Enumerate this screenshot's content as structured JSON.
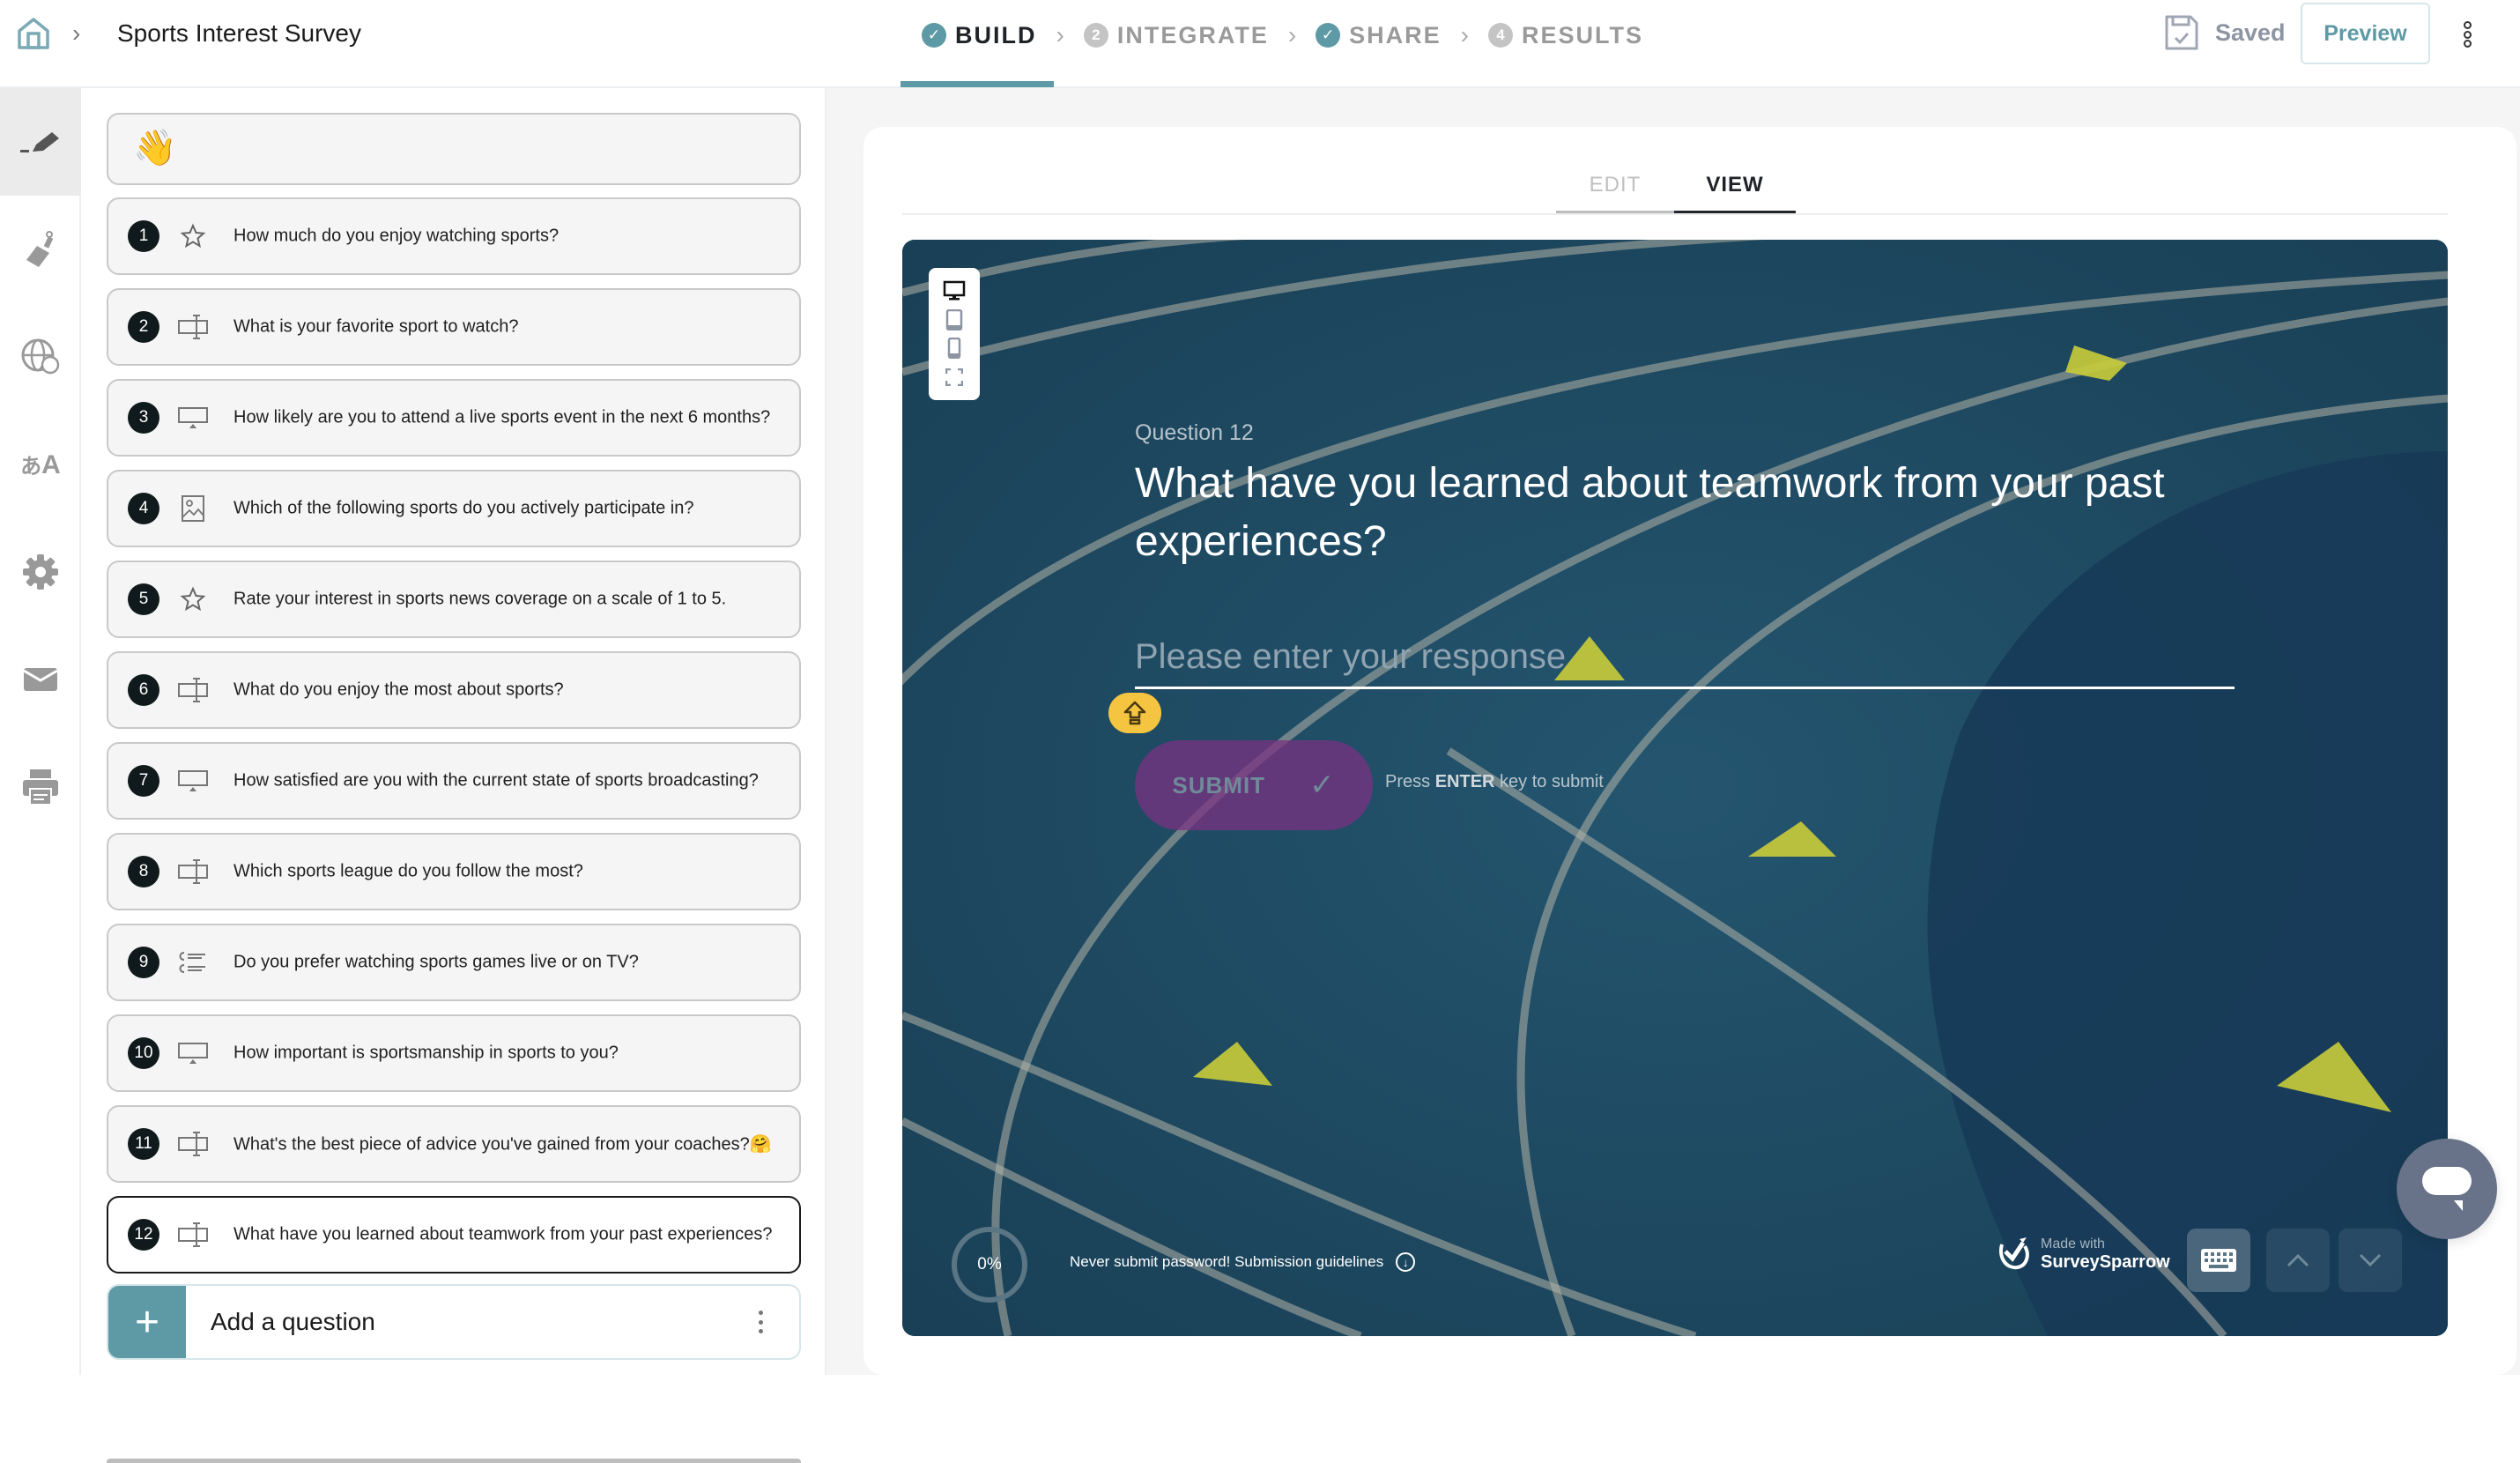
{
  "header": {
    "breadcrumb_title": "Sports Interest Survey",
    "steps": [
      {
        "label": "BUILD",
        "marker": "✓",
        "state": "done",
        "active": true
      },
      {
        "label": "INTEGRATE",
        "marker": "2",
        "state": "todo",
        "active": false
      },
      {
        "label": "SHARE",
        "marker": "✓",
        "state": "done",
        "active": false
      },
      {
        "label": "RESULTS",
        "marker": "4",
        "state": "todo",
        "active": false
      }
    ],
    "saved_label": "Saved",
    "preview_label": "Preview"
  },
  "rail": {
    "items": [
      {
        "name": "build",
        "icon": "pen-icon",
        "active": true
      },
      {
        "name": "design",
        "icon": "paint-brush-icon",
        "active": false
      },
      {
        "name": "web-settings",
        "icon": "globe-icon",
        "active": false
      },
      {
        "name": "translate",
        "icon": "translate-icon",
        "active": false
      },
      {
        "name": "settings",
        "icon": "gear-icon",
        "active": false
      },
      {
        "name": "email",
        "icon": "envelope-icon",
        "active": false
      },
      {
        "name": "print",
        "icon": "printer-icon",
        "active": false
      }
    ]
  },
  "questions": {
    "welcome_emoji": "👋",
    "items": [
      {
        "number": "1",
        "type": "rating",
        "icon": "star-icon",
        "text": "How much do you enjoy watching sports?"
      },
      {
        "number": "2",
        "type": "text",
        "icon": "text-input-icon",
        "text": "What is your favorite sport to watch?"
      },
      {
        "number": "3",
        "type": "opinion-scale",
        "icon": "presentation-icon",
        "text": "How likely are you to attend a live sports event in the next 6 months?"
      },
      {
        "number": "4",
        "type": "picture-choice",
        "icon": "image-icon",
        "text": "Which of the following sports do you actively participate in?"
      },
      {
        "number": "5",
        "type": "rating",
        "icon": "star-icon",
        "text": "Rate your interest in sports news coverage on a scale of 1 to 5."
      },
      {
        "number": "6",
        "type": "text",
        "icon": "text-input-icon",
        "text": "What do you enjoy the most about sports?"
      },
      {
        "number": "7",
        "type": "opinion-scale",
        "icon": "presentation-icon",
        "text": "How satisfied are you with the current state of sports broadcasting?"
      },
      {
        "number": "8",
        "type": "text",
        "icon": "text-input-icon",
        "text": "Which sports league do you follow the most?"
      },
      {
        "number": "9",
        "type": "multiple-choice",
        "icon": "choice-list-icon",
        "text": "Do you prefer watching sports games live or on TV?"
      },
      {
        "number": "10",
        "type": "opinion-scale",
        "icon": "presentation-icon",
        "text": "How important is sportsmanship in sports to you?"
      },
      {
        "number": "11",
        "type": "text",
        "icon": "text-input-icon",
        "text": "What's the best piece of advice you've gained from your coaches?🤗"
      },
      {
        "number": "12",
        "type": "text",
        "icon": "text-input-icon",
        "text": "What have you learned about teamwork from your past experiences?",
        "selected": true
      }
    ],
    "add_label": "Add a question"
  },
  "editor": {
    "tabs": [
      {
        "label": "EDIT",
        "active": false
      },
      {
        "label": "VIEW",
        "active": true
      }
    ]
  },
  "preview": {
    "device_options": [
      "desktop",
      "tablet",
      "mobile",
      "fullscreen"
    ],
    "selected_device": "desktop",
    "question_label": "Question 12",
    "question_title": "What have you learned about teamwork from your past experiences?",
    "input_placeholder": "Please enter your response",
    "input_value": "",
    "submit_label": "SUBMIT",
    "hint_prefix": "Press ",
    "hint_key": "ENTER",
    "hint_suffix": " key to submit",
    "progress_percent": "0%",
    "guidelines_text": "Never submit password! Submission guidelines",
    "made_with_small": "Made with",
    "made_with_brand": "SurveySparrow"
  },
  "colors": {
    "accent": "#5e9aa5",
    "submit_bg": "#7a3282",
    "shift_badge": "#f5c542",
    "chat_fab": "#687389"
  }
}
